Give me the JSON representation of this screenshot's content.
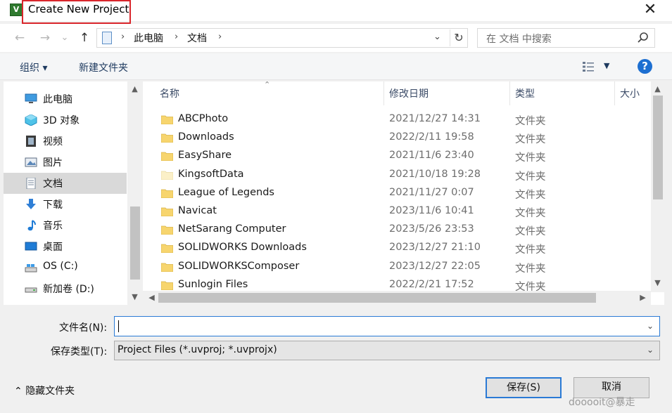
{
  "window": {
    "title": "Create New Project",
    "app_icon": "keil-uvision-icon",
    "close_glyph": "✕",
    "highlight_color": "#d9262c"
  },
  "nav": {
    "back_glyph": "←",
    "forward_glyph": "→",
    "recent_glyph": "⌄",
    "up_glyph": "↑",
    "breadcrumb": [
      "此电脑",
      "文档"
    ],
    "search_placeholder": "在 文档 中搜索"
  },
  "toolbar": {
    "organize": "组织 ▾",
    "new_folder": "新建文件夹",
    "help": "?"
  },
  "sidebar": {
    "items": [
      {
        "label": "此电脑",
        "icon": "computer-icon",
        "selected": false
      },
      {
        "label": "3D 对象",
        "icon": "3d-objects-icon",
        "selected": false
      },
      {
        "label": "视频",
        "icon": "video-icon",
        "selected": false
      },
      {
        "label": "图片",
        "icon": "pictures-icon",
        "selected": false
      },
      {
        "label": "文档",
        "icon": "documents-icon",
        "selected": true
      },
      {
        "label": "下载",
        "icon": "download-icon",
        "selected": false
      },
      {
        "label": "音乐",
        "icon": "music-icon",
        "selected": false
      },
      {
        "label": "桌面",
        "icon": "desktop-icon",
        "selected": false
      },
      {
        "label": "OS (C:)",
        "icon": "drive-icon",
        "selected": false
      },
      {
        "label": "新加卷 (D:)",
        "icon": "drive-icon",
        "selected": false
      }
    ]
  },
  "filelist": {
    "columns": {
      "name": "名称",
      "date": "修改日期",
      "type": "类型",
      "size": "大小"
    },
    "rows": [
      {
        "name": "ABCPhoto",
        "date": "2021/12/27 14:31",
        "type": "文件夹"
      },
      {
        "name": "Downloads",
        "date": "2022/2/11 19:58",
        "type": "文件夹"
      },
      {
        "name": "EasyShare",
        "date": "2021/11/6 23:40",
        "type": "文件夹"
      },
      {
        "name": "KingsoftData",
        "date": "2021/10/18 19:28",
        "type": "文件夹"
      },
      {
        "name": "League of Legends",
        "date": "2021/11/27 0:07",
        "type": "文件夹"
      },
      {
        "name": "Navicat",
        "date": "2023/11/6 10:41",
        "type": "文件夹"
      },
      {
        "name": "NetSarang Computer",
        "date": "2023/5/26 23:53",
        "type": "文件夹"
      },
      {
        "name": "SOLIDWORKS Downloads",
        "date": "2023/12/27 21:10",
        "type": "文件夹"
      },
      {
        "name": "SOLIDWORKSComposer",
        "date": "2023/12/27 22:05",
        "type": "文件夹"
      },
      {
        "name": "Sunlogin Files",
        "date": "2022/2/21 17:52",
        "type": "文件夹"
      }
    ]
  },
  "form": {
    "filename_label": "文件名(N):",
    "filename_value": "",
    "filetype_label": "保存类型(T):",
    "filetype_value": "Project Files (*.uvproj; *.uvprojx)"
  },
  "footer": {
    "hide_folders": "隐藏文件夹",
    "save": "保存(S)",
    "cancel": "取消",
    "watermark": "dooooit@暴走"
  },
  "colors": {
    "accent": "#2a7ad5",
    "folder": "#f7d56e",
    "help": "#1d6fd1"
  }
}
